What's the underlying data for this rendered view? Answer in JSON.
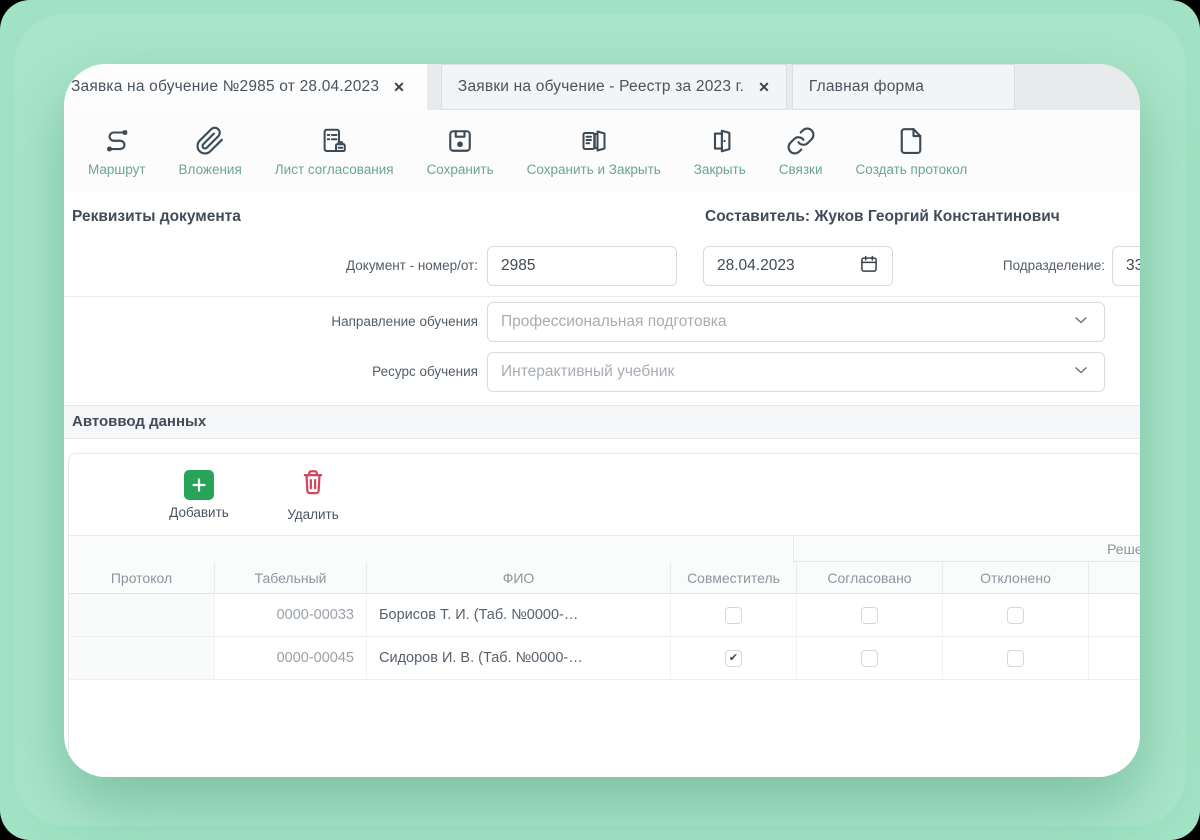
{
  "ui": {
    "close_glyph": "✕"
  },
  "colors": {
    "background_mint": "#a0e2c3",
    "toolbar_label_green": "#6aa78c",
    "add_button_green": "#27a458",
    "delete_icon_red": "#d5455f",
    "icon_dark": "#3b4a54"
  },
  "tabs": [
    {
      "label": "Заявка на обучение №2985 от 28.04.2023",
      "active": true,
      "closable": true
    },
    {
      "label": "Заявки на обучение - Реестр за 2023 г.",
      "active": false,
      "closable": true
    },
    {
      "label": "Главная форма",
      "active": false,
      "closable": false
    }
  ],
  "toolbar": {
    "items": [
      {
        "label": "Маршрут",
        "icon": "route-icon"
      },
      {
        "label": "Вложения",
        "icon": "paperclip-icon"
      },
      {
        "label": "Лист согласования",
        "icon": "approval-sheet-icon"
      },
      {
        "label": "Сохранить",
        "icon": "save-icon"
      },
      {
        "label": "Сохранить и Закрыть",
        "icon": "save-close-icon"
      },
      {
        "label": "Закрыть",
        "icon": "door-close-icon"
      },
      {
        "label": "Связки",
        "icon": "links-icon"
      },
      {
        "label": "Создать протокол",
        "icon": "new-document-icon"
      }
    ]
  },
  "form": {
    "section_title": "Реквизиты документа",
    "author": "Составитель: Жуков Георгий Константинович",
    "doc_label": "Документ - номер/от:",
    "doc_number": "2985",
    "doc_date": "28.04.2023",
    "department_label": "Подразделение:",
    "department_value": "33",
    "direction_label": "Направление обучения",
    "direction_value": "Профессиональная подготовка",
    "resource_label": "Ресурс обучения",
    "resource_value": "Интерактивный учебник"
  },
  "autoinput": {
    "section_title": "Автоввод данных",
    "add_label": "Добавить",
    "delete_label": "Удалить"
  },
  "grid": {
    "group_header": "Решение",
    "columns": [
      "Протокол",
      "Табельный",
      "ФИО",
      "Совместитель",
      "Согласовано",
      "Отклонено"
    ],
    "rows": [
      {
        "protocol": "",
        "tab_number": "0000-00033",
        "fio": "Борисов Т. И. (Таб. №0000-…",
        "sovmestitel": false,
        "soglasovano": false,
        "otkloneno": false
      },
      {
        "protocol": "",
        "tab_number": "0000-00045",
        "fio": "Сидоров И. В. (Таб. №0000-…",
        "sovmestitel": true,
        "soglasovano": false,
        "otkloneno": false
      }
    ]
  }
}
